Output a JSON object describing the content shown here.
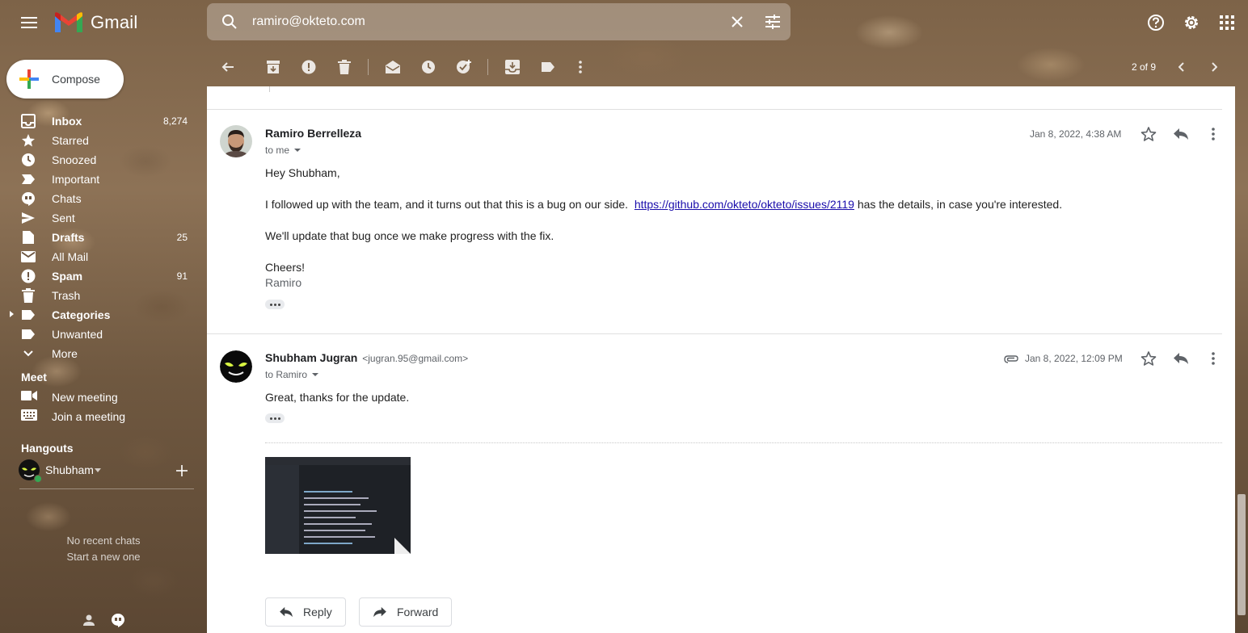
{
  "app": {
    "name": "Gmail"
  },
  "search": {
    "value": "ramiro@okteto.com"
  },
  "compose": {
    "label": "Compose"
  },
  "nav": {
    "items": [
      {
        "label": "Inbox",
        "count": "8,274"
      },
      {
        "label": "Starred",
        "count": ""
      },
      {
        "label": "Snoozed",
        "count": ""
      },
      {
        "label": "Important",
        "count": ""
      },
      {
        "label": "Chats",
        "count": ""
      },
      {
        "label": "Sent",
        "count": ""
      },
      {
        "label": "Drafts",
        "count": "25"
      },
      {
        "label": "All Mail",
        "count": ""
      },
      {
        "label": "Spam",
        "count": "91"
      },
      {
        "label": "Trash",
        "count": ""
      },
      {
        "label": "Categories",
        "count": ""
      },
      {
        "label": "Unwanted",
        "count": ""
      },
      {
        "label": "More",
        "count": ""
      }
    ]
  },
  "meet": {
    "title": "Meet",
    "new_meeting": "New meeting",
    "join_meeting": "Join a meeting"
  },
  "hangouts": {
    "title": "Hangouts",
    "user": "Shubham",
    "no_recent": "No recent chats",
    "start_new": "Start a new one"
  },
  "toolbar": {
    "count": "2 of 9"
  },
  "messages": [
    {
      "sender": "Ramiro Berrelleza",
      "recipient": "to me",
      "date": "Jan 8, 2022, 4:38 AM",
      "greeting": "Hey Shubham,",
      "para1_pre": "I followed up with the team, and it turns out that this is a bug on our side.",
      "link": "https://github.com/okteto/okteto/issues/2119",
      "para1_post": "has the details, in case you're interested.",
      "para2": "We'll update that bug once we make progress with the fix.",
      "closing": "Cheers!",
      "signature": "Ramiro"
    },
    {
      "sender": "Shubham Jugran",
      "sender_email": "<jugran.95@gmail.com>",
      "recipient": "to Ramiro",
      "date": "Jan 8, 2022, 12:09 PM",
      "body": "Great, thanks for the update."
    }
  ],
  "actions": {
    "reply": "Reply",
    "forward": "Forward"
  },
  "colors": {
    "gmail_red": "#ea4335",
    "link": "#1a0dab",
    "white": "#ffffff"
  }
}
